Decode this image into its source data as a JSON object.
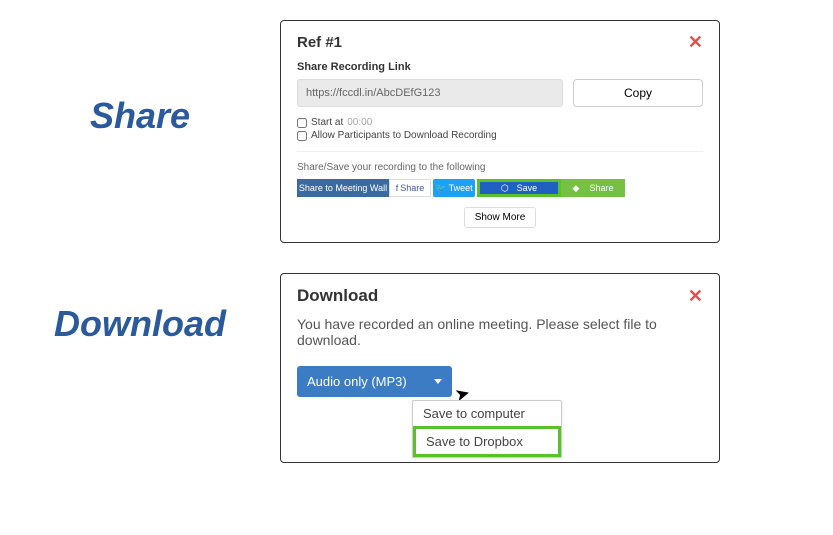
{
  "labels": {
    "share": "Share",
    "download": "Download"
  },
  "share_panel": {
    "title": "Ref #1",
    "link_label": "Share Recording Link",
    "link_value": "https://fccdl.in/AbcDEfG123",
    "copy_label": "Copy",
    "start_at_label": "Start at",
    "start_at_placeholder": "00:00",
    "allow_participants_label": "Allow Participants to Download Recording",
    "share_save_label": "Share/Save your recording to the following",
    "buttons": {
      "meeting_wall": "Share to Meeting Wall",
      "fb": "Share",
      "tw": "Tweet",
      "dropbox": "Save",
      "evernote": "Share"
    },
    "show_more": "Show More"
  },
  "download_panel": {
    "title": "Download",
    "message": "You have recorded an online meeting. Please select file to download.",
    "dropdown_label": "Audio only (MP3)",
    "menu": {
      "save_computer": "Save to computer",
      "save_dropbox": "Save to Dropbox"
    }
  }
}
